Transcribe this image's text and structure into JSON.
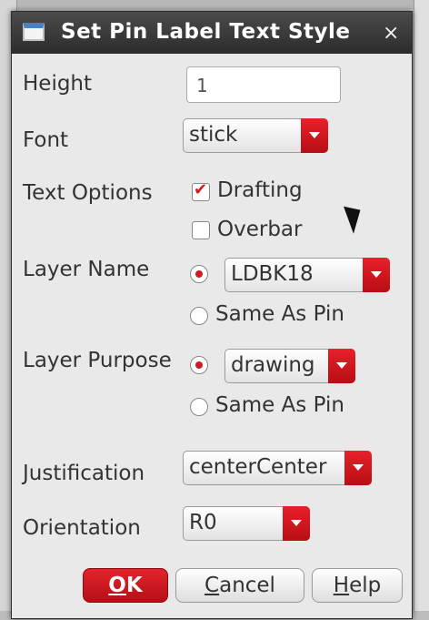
{
  "dialog": {
    "title": "Set Pin Label Text Style",
    "close_label": "×"
  },
  "height": {
    "label": "Height",
    "value": "1"
  },
  "font": {
    "label": "Font",
    "value": "stick"
  },
  "text_options": {
    "label": "Text Options",
    "drafting": {
      "label": "Drafting",
      "checked": true
    },
    "overbar": {
      "label": "Overbar",
      "checked": false
    }
  },
  "layer_name": {
    "label": "Layer Name",
    "value": "LDBK18",
    "same_as_pin": "Same As Pin"
  },
  "layer_purpose": {
    "label": "Layer Purpose",
    "value": "drawing",
    "same_as_pin": "Same As Pin"
  },
  "justification": {
    "label": "Justification",
    "value": "centerCenter"
  },
  "orientation": {
    "label": "Orientation",
    "value": "R0"
  },
  "buttons": {
    "ok_first": "O",
    "ok_rest": "K",
    "cancel_first": "C",
    "cancel_rest": "ancel",
    "help_first": "H",
    "help_rest": "elp"
  },
  "colors": {
    "accent": "#d41a22",
    "titlebar": "#3a3a3a",
    "panel": "#e9e9e9"
  },
  "icons": [
    "window-icon",
    "close-icon",
    "dropdown-arrow-icon",
    "checkmark-icon",
    "radio-dot-icon",
    "mouse-cursor-icon"
  ]
}
